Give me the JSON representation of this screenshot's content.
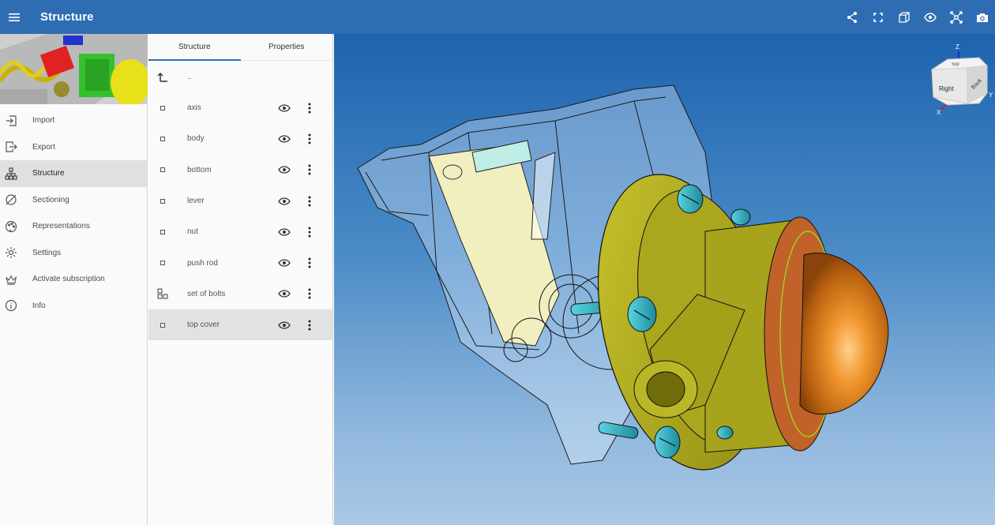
{
  "appbar": {
    "title": "Structure",
    "menu_icon": "menu-icon",
    "actions": [
      "share-icon",
      "fit-view-icon",
      "perspective-cube-icon",
      "visibility-icon",
      "explode-icon",
      "camera-icon"
    ]
  },
  "drawer": {
    "items": [
      {
        "label": "Import",
        "icon": "import-icon"
      },
      {
        "label": "Export",
        "icon": "export-icon"
      },
      {
        "label": "Structure",
        "icon": "structure-tree-icon"
      },
      {
        "label": "Sectioning",
        "icon": "sectioning-icon"
      },
      {
        "label": "Representations",
        "icon": "representations-icon"
      },
      {
        "label": "Settings",
        "icon": "gear-icon"
      },
      {
        "label": "Activate subscription",
        "icon": "crown-icon"
      },
      {
        "label": "Info",
        "icon": "info-icon"
      }
    ],
    "active": "Structure"
  },
  "panel": {
    "tabs": [
      "Structure",
      "Properties"
    ],
    "active_tab": "Structure",
    "up_label": "..",
    "rows": [
      {
        "label": "axis",
        "type": "part"
      },
      {
        "label": "body",
        "type": "part"
      },
      {
        "label": "bottom",
        "type": "part"
      },
      {
        "label": "lever",
        "type": "part"
      },
      {
        "label": "nut",
        "type": "part"
      },
      {
        "label": "push rod",
        "type": "part"
      },
      {
        "label": "set of bolts",
        "type": "assembly"
      },
      {
        "label": "top cover",
        "type": "part"
      }
    ],
    "selected_row": "top cover"
  },
  "viewport": {
    "navigation_cube": {
      "faces": [
        "Right",
        "Back",
        "Top"
      ],
      "axes": [
        "X",
        "Y",
        "Z"
      ]
    },
    "colors": {
      "background_top": "#1d63ae",
      "background_bottom": "#a9c8e6",
      "flange": "#a9a81e",
      "dome": "#d9791b",
      "bolts": "#35a7b9"
    }
  }
}
